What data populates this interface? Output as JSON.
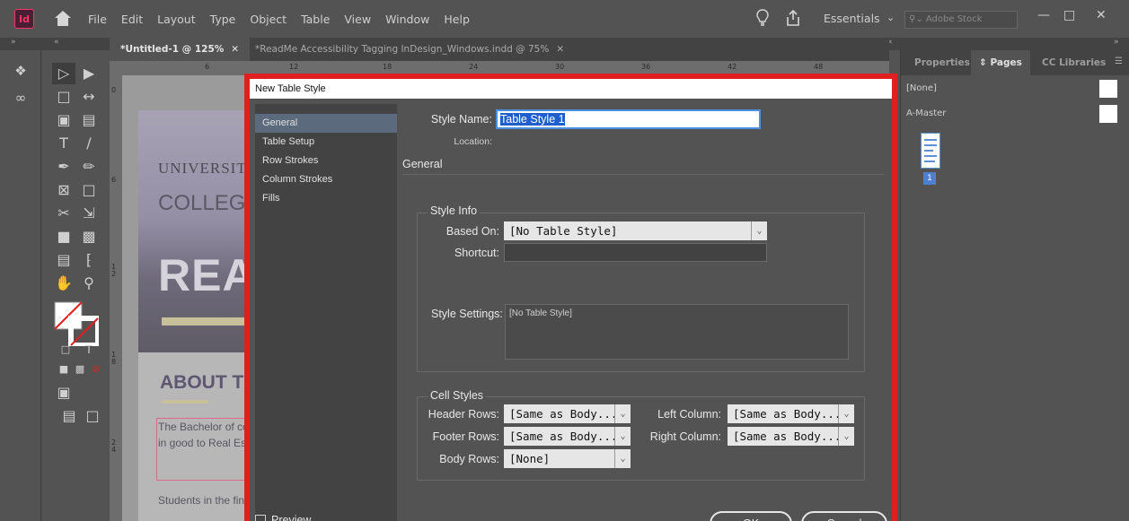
{
  "app": {
    "icon_label": "Id",
    "menu": [
      "File",
      "Edit",
      "Layout",
      "Type",
      "Object",
      "Table",
      "View",
      "Window",
      "Help"
    ],
    "workspace": "Essentials",
    "stock_search_placeholder": "Adobe Stock"
  },
  "doc_tabs": [
    {
      "label": "*Untitled-1 @ 125%"
    },
    {
      "label": "*ReadMe Accessibility Tagging InDesign_Windows.indd @ 75%"
    }
  ],
  "ruler": {
    "h_ticks": [
      "6",
      "12",
      "18",
      "24",
      "30",
      "36",
      "42",
      "48"
    ],
    "v_ticks": [
      "0",
      "6",
      "1\n2",
      "1\n8",
      "2\n4"
    ]
  },
  "canvas_page": {
    "line1": "UNIVERSITY",
    "line2": "COLLEGE",
    "line3": "REA",
    "about": "ABOUT T",
    "body1": "The Bachelor of comprehensive students in good to Real Estate.",
    "body2": "Students in the financing, devel"
  },
  "right_panel": {
    "tabs": [
      "Properties",
      "Pages",
      "CC Libraries"
    ],
    "rows": [
      "[None]",
      "A-Master"
    ],
    "page_number": "1"
  },
  "dialog": {
    "title": "New Table Style",
    "categories": [
      "General",
      "Table Setup",
      "Row Strokes",
      "Column Strokes",
      "Fills"
    ],
    "style_name_label": "Style Name:",
    "style_name_value": "Table Style 1",
    "location_label": "Location:",
    "section_title": "General",
    "style_info": {
      "title": "Style Info",
      "based_on_label": "Based On:",
      "based_on_value": "[No Table Style]",
      "shortcut_label": "Shortcut:"
    },
    "style_settings_label": "Style Settings:",
    "style_settings_value": "[No Table Style]",
    "cell_styles": {
      "title": "Cell Styles",
      "header_rows_label": "Header Rows:",
      "header_rows_value": "[Same as Body...",
      "footer_rows_label": "Footer Rows:",
      "footer_rows_value": "[Same as Body...",
      "body_rows_label": "Body Rows:",
      "body_rows_value": "[None]",
      "left_column_label": "Left Column:",
      "left_column_value": "[Same as Body...",
      "right_column_label": "Right Column:",
      "right_column_value": "[Same as Body..."
    },
    "preview_label": "Preview",
    "ok_label": "OK",
    "cancel_label": "Cancel"
  },
  "colors": {
    "highlight_border": "#e02020",
    "selection": "#1f5fcc"
  }
}
